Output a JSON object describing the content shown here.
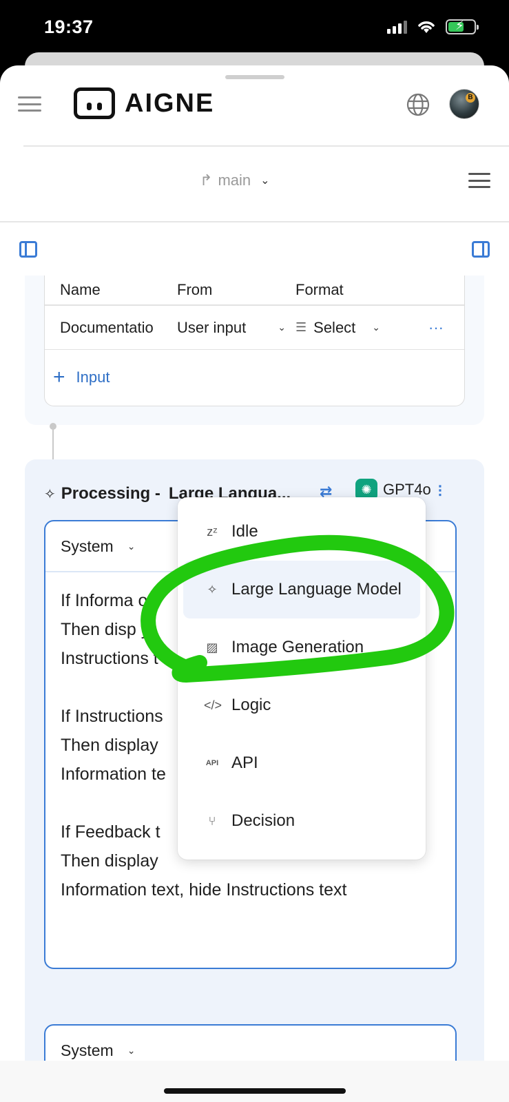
{
  "status_bar": {
    "time": "19:37"
  },
  "header": {
    "brand": "AIGNE"
  },
  "branch": {
    "name": "main"
  },
  "inputs_table": {
    "columns": [
      "Name",
      "From",
      "Format"
    ],
    "row": {
      "name": "Documentatio",
      "from": "User input",
      "format": "Select",
      "more": "···"
    },
    "add_label": "Input"
  },
  "processing": {
    "title": "Processing -",
    "type": "Large Langua...",
    "model": "GPT4o"
  },
  "prompt": {
    "role": "System",
    "text": "If Informa on\nThen disp  y\nInstructions t\n\nIf Instructions\nThen display\nInformation te\n\nIf Feedback t\nThen display\nInformation text, hide Instructions text"
  },
  "prompt2": {
    "role": "System"
  },
  "dropdown": {
    "items": [
      {
        "label": "Idle",
        "icon": "sleep-icon"
      },
      {
        "label": "Large Language Model",
        "icon": "sparkle-icon"
      },
      {
        "label": "Image Generation",
        "icon": "image-icon"
      },
      {
        "label": "Logic",
        "icon": "code-icon"
      },
      {
        "label": "API",
        "icon": "api-icon"
      },
      {
        "label": "Decision",
        "icon": "branch-icon"
      }
    ]
  },
  "colors": {
    "accent": "#3a7bd5",
    "annotation": "#22c90f",
    "openai": "#10a37f"
  }
}
